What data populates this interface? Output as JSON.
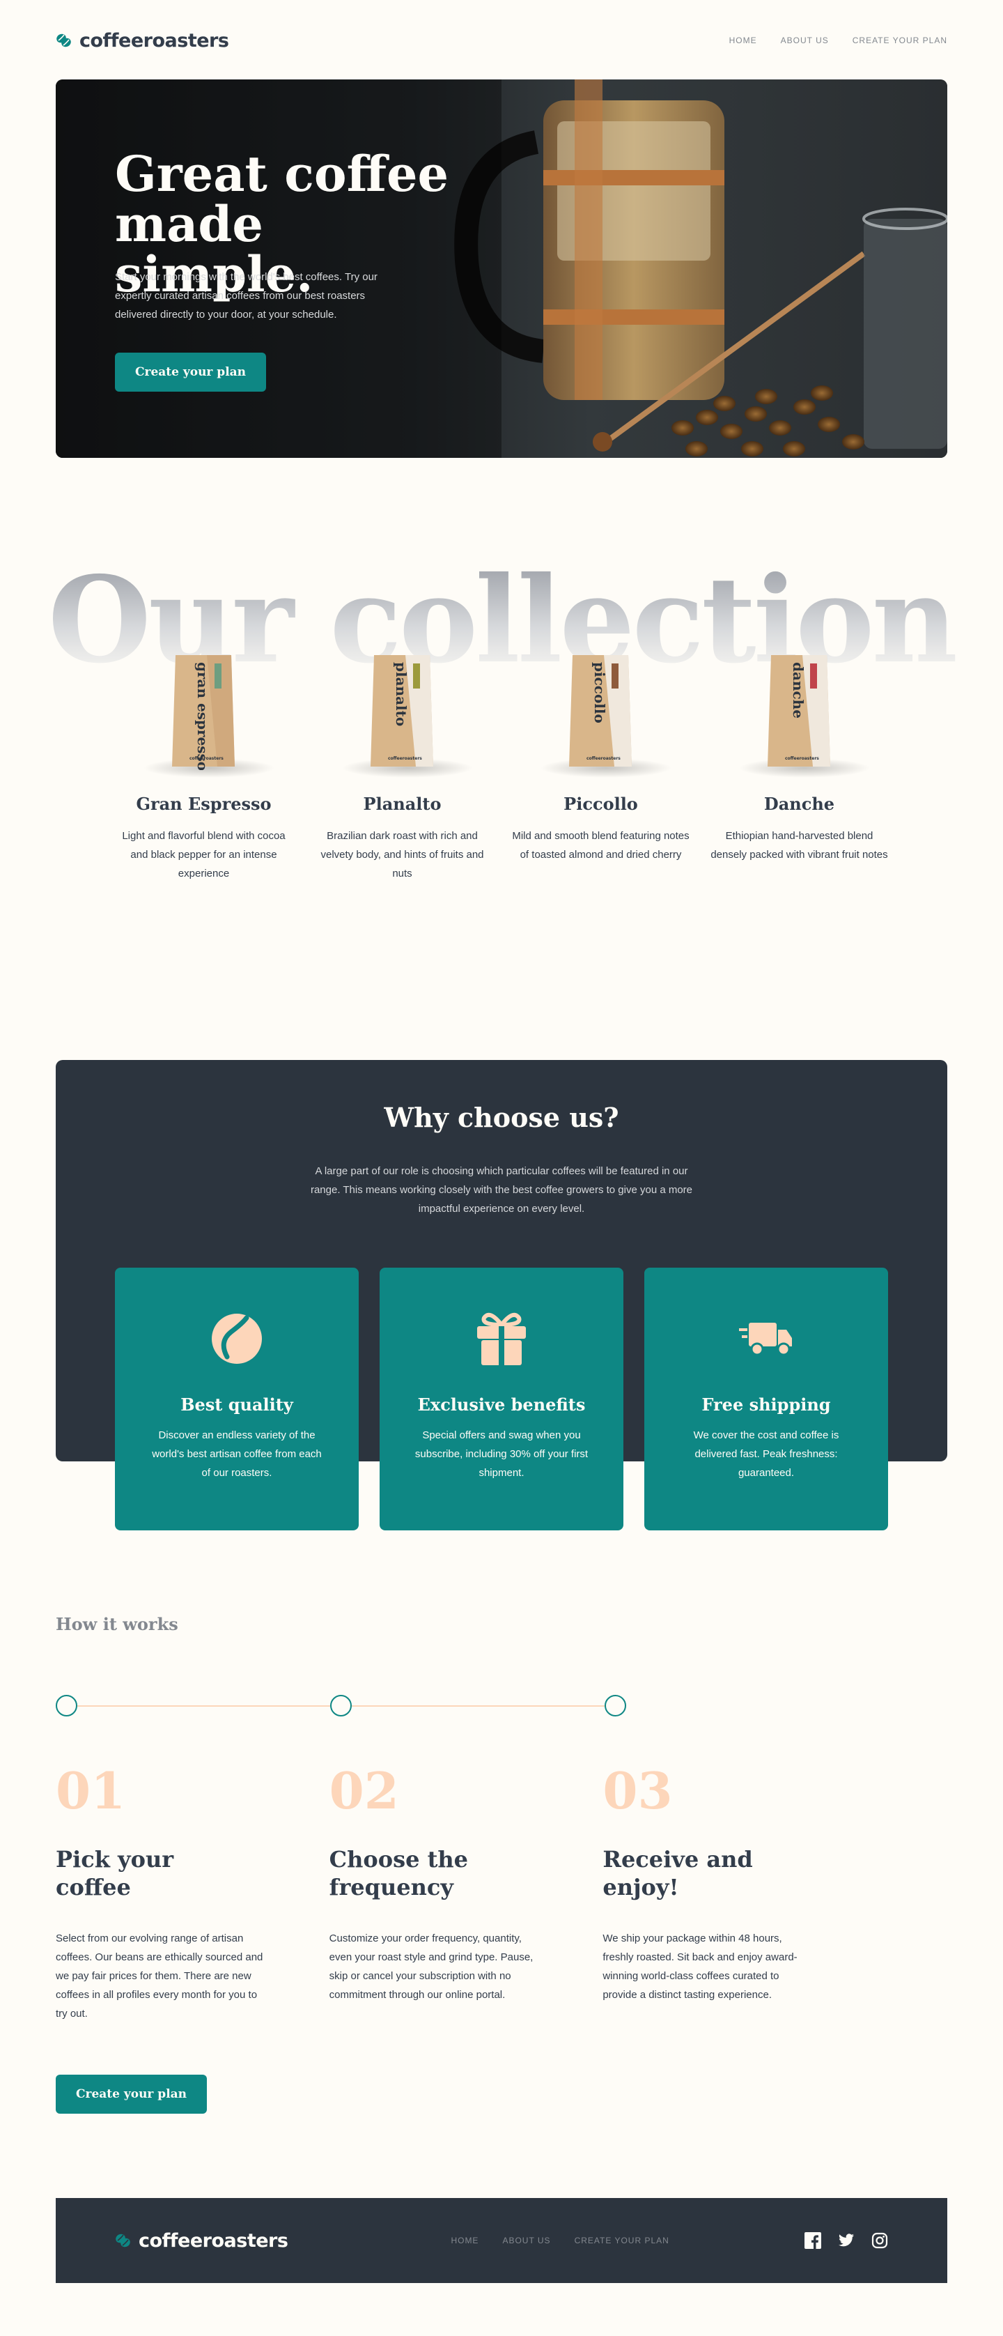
{
  "brand": {
    "name": "coffeeroasters"
  },
  "nav": {
    "items": [
      "HOME",
      "ABOUT US",
      "CREATE YOUR PLAN"
    ]
  },
  "hero": {
    "title": "Great coffee made simple.",
    "text": "Start your mornings with the world's best coffees. Try our expertly curated artisan coffees from our best roasters delivered directly to your door, at your schedule.",
    "cta": "Create your plan"
  },
  "collection": {
    "title": "Our collection",
    "products": [
      {
        "name": "Gran Espresso",
        "bag_label": "gran espresso",
        "desc": "Light and flavorful blend with cocoa and black pepper for an intense experience",
        "accent": "#6E9E80"
      },
      {
        "name": "Planalto",
        "bag_label": "planalto",
        "desc": "Brazilian dark roast with rich and velvety body, and hints of fruits and nuts",
        "accent": "#9C9A3C"
      },
      {
        "name": "Piccollo",
        "bag_label": "piccollo",
        "desc": "Mild and smooth blend featuring notes of toasted almond and dried cherry",
        "accent": "#8E5B3C"
      },
      {
        "name": "Danche",
        "bag_label": "danche",
        "desc": "Ethiopian hand-harvested blend densely packed with vibrant fruit notes",
        "accent": "#C0444B"
      }
    ],
    "bag_brand": "coffeeroasters"
  },
  "why": {
    "title": "Why choose us?",
    "text": "A large part of our role is choosing which particular coffees will be featured in our range. This means working closely with the best coffee growers to give you a more impactful experience on every level.",
    "cards": [
      {
        "icon": "coffee-bean-icon",
        "title": "Best quality",
        "text": "Discover an endless variety of the world's best artisan coffee from each of our roasters."
      },
      {
        "icon": "gift-icon",
        "title": "Exclusive benefits",
        "text": "Special offers and swag when you subscribe, including 30% off your first shipment."
      },
      {
        "icon": "truck-icon",
        "title": "Free shipping",
        "text": "We cover the cost and coffee is delivered fast. Peak freshness: guaranteed."
      }
    ]
  },
  "how": {
    "title": "How it works",
    "steps": [
      {
        "num": "01",
        "title": "Pick your coffee",
        "text": "Select from our evolving range of artisan coffees. Our beans are ethically sourced and we pay fair prices for them. There are new coffees in all profiles every month for you to try out."
      },
      {
        "num": "02",
        "title": "Choose the frequency",
        "text": "Customize your order frequency, quantity, even your roast style and grind type. Pause, skip or cancel your subscription with no commitment through our online portal."
      },
      {
        "num": "03",
        "title": "Receive and enjoy!",
        "text": "We ship your package within 48 hours, freshly roasted. Sit back and enjoy award-winning world-class coffees curated to provide a distinct tasting experience."
      }
    ],
    "cta": "Create your plan"
  },
  "footer": {
    "nav": [
      "HOME",
      "ABOUT US",
      "CREATE YOUR PLAN"
    ],
    "social": [
      "facebook-icon",
      "twitter-icon",
      "instagram-icon"
    ]
  },
  "colors": {
    "accent": "#0E8784",
    "dark": "#2C343E",
    "cream": "#FEFCF7",
    "peach": "#FDD6BA",
    "grey": "#83888F"
  }
}
